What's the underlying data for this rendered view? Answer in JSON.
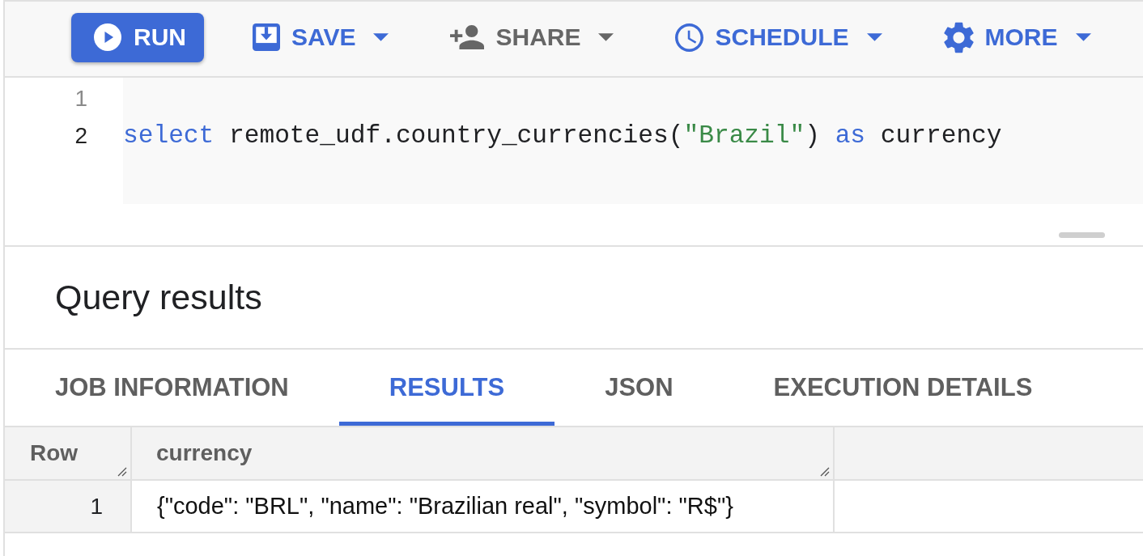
{
  "toolbar": {
    "buttons": [
      {
        "kind": "primary",
        "label": "RUN",
        "disabled": false
      },
      {
        "kind": "menu",
        "label": "SAVE",
        "disabled": false
      },
      {
        "kind": "menu",
        "label": "SHARE",
        "disabled": true
      },
      {
        "kind": "menu",
        "label": "SCHEDULE",
        "disabled": false
      },
      {
        "kind": "menu",
        "label": "MORE",
        "disabled": false
      }
    ]
  },
  "editor": {
    "lines": [
      {
        "number": "1",
        "active": false
      },
      {
        "number": "2",
        "active": true,
        "tokens": [
          {
            "kind": "keyword",
            "text": "select"
          },
          {
            "kind": "plain",
            "text": " remote_udf.country_currencies("
          },
          {
            "kind": "string",
            "text": "\"Brazil\""
          },
          {
            "kind": "plain",
            "text": ") "
          },
          {
            "kind": "keyword",
            "text": "as"
          },
          {
            "kind": "plain",
            "text": " currency"
          }
        ]
      }
    ]
  },
  "results": {
    "title": "Query results",
    "tabs": [
      {
        "label": "JOB INFORMATION",
        "selected": false
      },
      {
        "label": "RESULTS",
        "selected": true
      },
      {
        "label": "JSON",
        "selected": false
      },
      {
        "label": "EXECUTION DETAILS",
        "selected": false
      }
    ],
    "table": {
      "columns": [
        "Row",
        "currency"
      ],
      "rows": [
        {
          "row": "1",
          "currency": "{\"code\": \"BRL\", \"name\": \"Brazilian real\", \"symbol\": \"R$\"}"
        }
      ]
    }
  }
}
